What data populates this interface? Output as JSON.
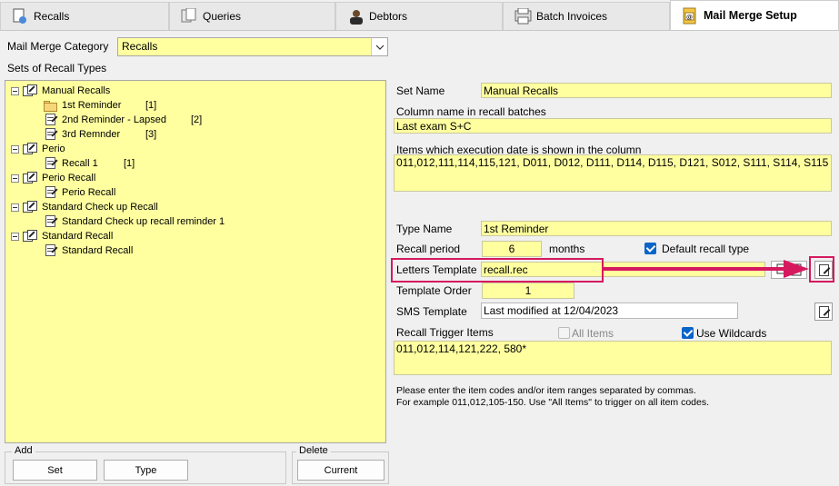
{
  "tabs": [
    {
      "label": "Recalls",
      "icon": "recalls-icon"
    },
    {
      "label": "Queries",
      "icon": "queries-icon"
    },
    {
      "label": "Debtors",
      "icon": "debtors-icon"
    },
    {
      "label": "Batch Invoices",
      "icon": "batch-invoices-icon"
    },
    {
      "label": "Mail Merge Setup",
      "icon": "mail-merge-icon",
      "active": true
    }
  ],
  "category": {
    "label": "Mail Merge Category",
    "value": "Recalls"
  },
  "sets_label": "Sets of Recall Types",
  "tree": [
    {
      "text": "Manual Recalls",
      "level": 0,
      "kind": "set"
    },
    {
      "text": "1st Reminder",
      "count": "[1]",
      "level": 1,
      "kind": "folder"
    },
    {
      "text": "2nd Reminder - Lapsed",
      "count": "[2]",
      "level": 1,
      "kind": "doc"
    },
    {
      "text": "3rd Remnder",
      "count": "[3]",
      "level": 1,
      "kind": "doc"
    },
    {
      "text": "Perio",
      "level": 0,
      "kind": "set"
    },
    {
      "text": "Recall 1",
      "count": "[1]",
      "level": 1,
      "kind": "doc"
    },
    {
      "text": "Perio Recall",
      "level": 0,
      "kind": "set"
    },
    {
      "text": "Perio Recall",
      "level": 1,
      "kind": "doc"
    },
    {
      "text": "Standard Check up Recall",
      "level": 0,
      "kind": "set"
    },
    {
      "text": "Standard Check up recall reminder 1",
      "level": 1,
      "kind": "doc"
    },
    {
      "text": "Standard Recall",
      "level": 0,
      "kind": "set"
    },
    {
      "text": "Standard Recall",
      "level": 1,
      "kind": "doc"
    }
  ],
  "add": {
    "title": "Add",
    "set_label": "Set",
    "type_label": "Type"
  },
  "delete": {
    "title": "Delete",
    "current_label": "Current"
  },
  "set_name": {
    "label": "Set Name",
    "value": "Manual Recalls"
  },
  "column_name": {
    "label": "Column name in recall batches",
    "value": "Last exam S+C"
  },
  "items_exec": {
    "label": "Items which execution date is shown in the column",
    "value": "011,012,111,114,115,121, D011, D012, D111, D114, D115, D121, S012, S111, S114, S115"
  },
  "type_name": {
    "label": "Type Name",
    "value": "1st Reminder"
  },
  "recall_period": {
    "label": "Recall period",
    "value": "6",
    "unit": "months"
  },
  "default_recall": {
    "label": "Default recall type",
    "checked": true
  },
  "letters_template": {
    "label": "Letters Template",
    "value": "recall.rec"
  },
  "template_order": {
    "label": "Template Order",
    "value": "1"
  },
  "sms_template": {
    "label": "SMS Template",
    "value": "Last modified at 12/04/2023"
  },
  "trigger": {
    "label": "Recall Trigger Items",
    "all_items_label": "All Items",
    "all_items_checked": false,
    "wildcards_label": "Use Wildcards",
    "wildcards_checked": true,
    "value": "011,012,114,121,222, 580*"
  },
  "help": {
    "line1": "Please enter the item codes and/or item ranges separated by commas.",
    "line2": "For example 011,012,105-150. Use \"All Items\" to trigger on all item codes."
  },
  "colors": {
    "highlight": "#d6195f",
    "field_bg": "#ffffa0",
    "checkbox": "#0a64c8"
  }
}
